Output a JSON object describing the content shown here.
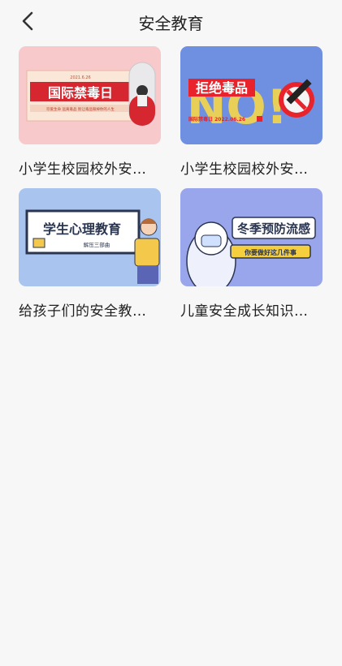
{
  "header": {
    "title": "安全教育",
    "back_icon": "chevron-left-icon"
  },
  "cards": [
    {
      "title": "小学生校园校外安…",
      "thumb": {
        "date": "2021.6.26",
        "heading": "国际禁毒日",
        "slogan": "珍爱生命 远离毒品 别让毒品毁掉你的人生",
        "bg": "#f7c9cb",
        "accent": "#d6262f"
      }
    },
    {
      "title": "小学生校园校外安…",
      "thumb": {
        "heading": "拒绝毒品",
        "big": "NO!",
        "sub": "国际禁毒日 2022.06.26",
        "bg": "#6f8fe0",
        "accent": "#e8232c",
        "highlight": "#f6d64a"
      }
    },
    {
      "title": "给孩子们的安全教…",
      "thumb": {
        "heading": "学生心理教育",
        "sub": "解压三部曲",
        "bg": "#a9c4ef",
        "accent": "#f4c94b"
      }
    },
    {
      "title": "儿童安全成长知识…",
      "thumb": {
        "heading": "冬季预防流感",
        "sub": "你要做好这几件事",
        "bg": "#9aa6ec",
        "accent": "#f6cf3e"
      }
    }
  ]
}
